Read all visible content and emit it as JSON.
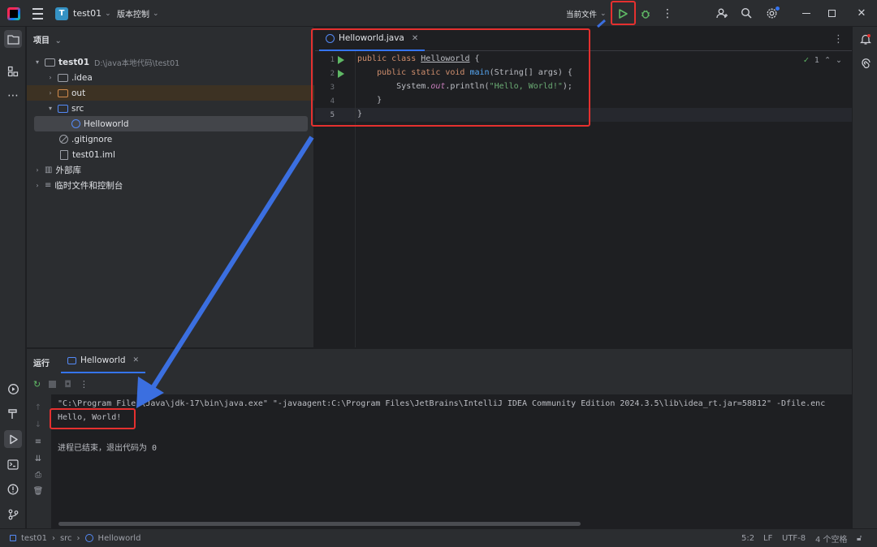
{
  "titlebar": {
    "project_initial": "T",
    "project_name": "test01",
    "vcs_label": "版本控制",
    "run_config": "当前文件"
  },
  "project_panel": {
    "title": "项目",
    "root_name": "test01",
    "root_path": "D:\\java本地代码\\test01",
    "items": [
      {
        "label": ".idea"
      },
      {
        "label": "out"
      },
      {
        "label": "src"
      },
      {
        "label": "Helloworld"
      },
      {
        "label": ".gitignore"
      },
      {
        "label": "test01.iml"
      },
      {
        "label": "外部库"
      },
      {
        "label": "临时文件和控制台"
      }
    ]
  },
  "editor": {
    "tab_label": "Helloworld.java",
    "inspections_count": "1",
    "line_numbers": [
      "1",
      "2",
      "3",
      "4",
      "5"
    ],
    "code": {
      "l1_kw": "public class ",
      "l1_name": "Helloworld",
      "l1_end": " {",
      "l2_kw": "    public static void ",
      "l2_fn": "main",
      "l2_end": "(String[] args) {",
      "l3_a": "        System.",
      "l3_fld": "out",
      "l3_b": ".println(",
      "l3_str": "\"Hello, World!\"",
      "l3_c": ");",
      "l4": "    }",
      "l5": "}"
    }
  },
  "run_panel": {
    "title": "运行",
    "tab_label": "Helloworld",
    "console_lines": [
      "\"C:\\Program Files\\Java\\jdk-17\\bin\\java.exe\" \"-javaagent:C:\\Program Files\\JetBrains\\IntelliJ IDEA Community Edition 2024.3.5\\lib\\idea_rt.jar=58812\" -Dfile.enc",
      "Hello, World!",
      "进程已结束，退出代码为 0"
    ]
  },
  "statusbar": {
    "crumbs": [
      "test01",
      "src",
      "Helloworld"
    ],
    "position": "5:2",
    "line_sep": "LF",
    "encoding": "UTF-8",
    "indent": "4 个空格"
  },
  "colors": {
    "accent_blue": "#3574f0",
    "run_green": "#5fb865",
    "annotation_red": "#e5302f",
    "annotation_arrow": "#3b6fe0"
  }
}
